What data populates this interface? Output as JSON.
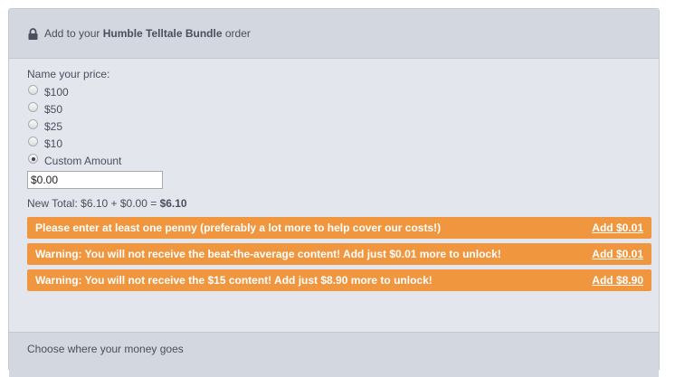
{
  "header": {
    "prefix": "Add to your",
    "bundle_name": "Humble Telltale Bundle",
    "suffix": "order",
    "icon": "lock-icon"
  },
  "price": {
    "label": "Name your price:",
    "options": [
      {
        "label": "$100",
        "checked": false
      },
      {
        "label": "$50",
        "checked": false
      },
      {
        "label": "$25",
        "checked": false
      },
      {
        "label": "$10",
        "checked": false
      },
      {
        "label": "Custom Amount",
        "checked": true
      }
    ],
    "custom_value": "$0.00"
  },
  "total": {
    "prefix": "New Total: $6.10 + $0.00 =",
    "value": "$6.10"
  },
  "warnings": [
    {
      "message": "Please enter at least one penny (preferably a lot more to help cover our costs!)",
      "action": "Add $0.01"
    },
    {
      "message": "Warning: You will not receive the beat-the-average content! Add just $0.01 more to unlock!",
      "action": "Add $0.01"
    },
    {
      "message": "Warning: You will not receive the $15 content! Add just $8.90 more to unlock!",
      "action": "Add $8.90"
    }
  ],
  "colors": {
    "warning_bg": "#f0963f",
    "panel_bg": "#e3e6ed",
    "header_bg": "#d3d7df"
  },
  "footer": {
    "label": "Choose where your money goes"
  }
}
